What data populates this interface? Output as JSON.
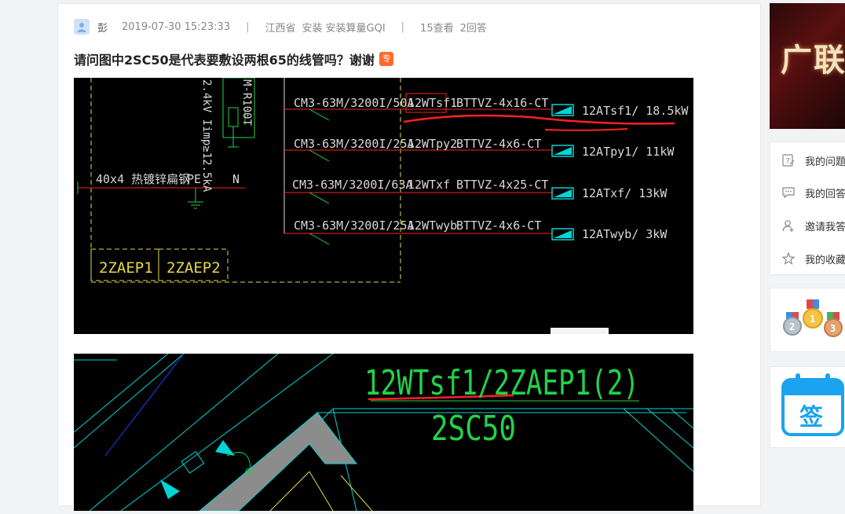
{
  "post": {
    "author": "彭",
    "datetime": "2019-07-30 15:23:33",
    "separator": "|",
    "location": "江西省",
    "category_1": "安装",
    "category_2": "安装算量GQI",
    "views": "15查看",
    "answers": "2回答",
    "title": "请问图中2SC50是代表要敷设两根65的线管吗？谢谢",
    "tag": "专"
  },
  "drawing1": {
    "left_texts": [
      "40x4 热镀锌扁钢",
      "PE",
      "N",
      "2ZAEP1",
      "2ZAEP2"
    ],
    "vertical_texts": [
      "2.4kV Iimp≥12.5kA",
      "M-R100T"
    ],
    "rows": [
      {
        "breaker": "CM3-63M/3200I/50A",
        "circuit": "12WTsf1",
        "cable": "BTTVZ-4x16-CT",
        "load": "12ATsf1/ 18.5kW"
      },
      {
        "breaker": "CM3-63M/3200I/25A",
        "circuit": "12WTpy2",
        "cable": "BTTVZ-4x6-CT",
        "load": "12ATpy1/ 11kW"
      },
      {
        "breaker": "CM3-63M/3200I/63A",
        "circuit": "12WTxf",
        "cable": "BTTVZ-4x25-CT",
        "load": "12ATxf/ 13kW"
      },
      {
        "breaker": "CM3-63M/3200I/25A",
        "circuit": "12WTwyb",
        "cable": "BTTVZ-4x6-CT",
        "load": "12ATwyb/ 3kW"
      }
    ]
  },
  "drawing2": {
    "label_top": "12WTsf1/2ZAEP1(2)",
    "label_bottom": "2SC50"
  },
  "sidebar": {
    "banner_text": "广联",
    "menu": [
      {
        "label": "我的问题",
        "icon": "question-doc-icon"
      },
      {
        "label": "我的回答",
        "icon": "comment-icon"
      },
      {
        "label": "邀请我答",
        "icon": "invite-user-icon"
      },
      {
        "label": "我的收藏",
        "icon": "star-icon"
      }
    ],
    "medal_numbers": [
      "2",
      "1",
      "3"
    ],
    "sign_label": "签"
  },
  "colors": {
    "cad_red": "#ff2020",
    "cad_white": "#d8d8d8",
    "cad_yellow": "#e8d84a",
    "cad_cyan": "#00d4d4",
    "cad_green": "#22d24a",
    "tag_orange": "#ff6a2b",
    "sign_blue": "#1aa3ee"
  }
}
